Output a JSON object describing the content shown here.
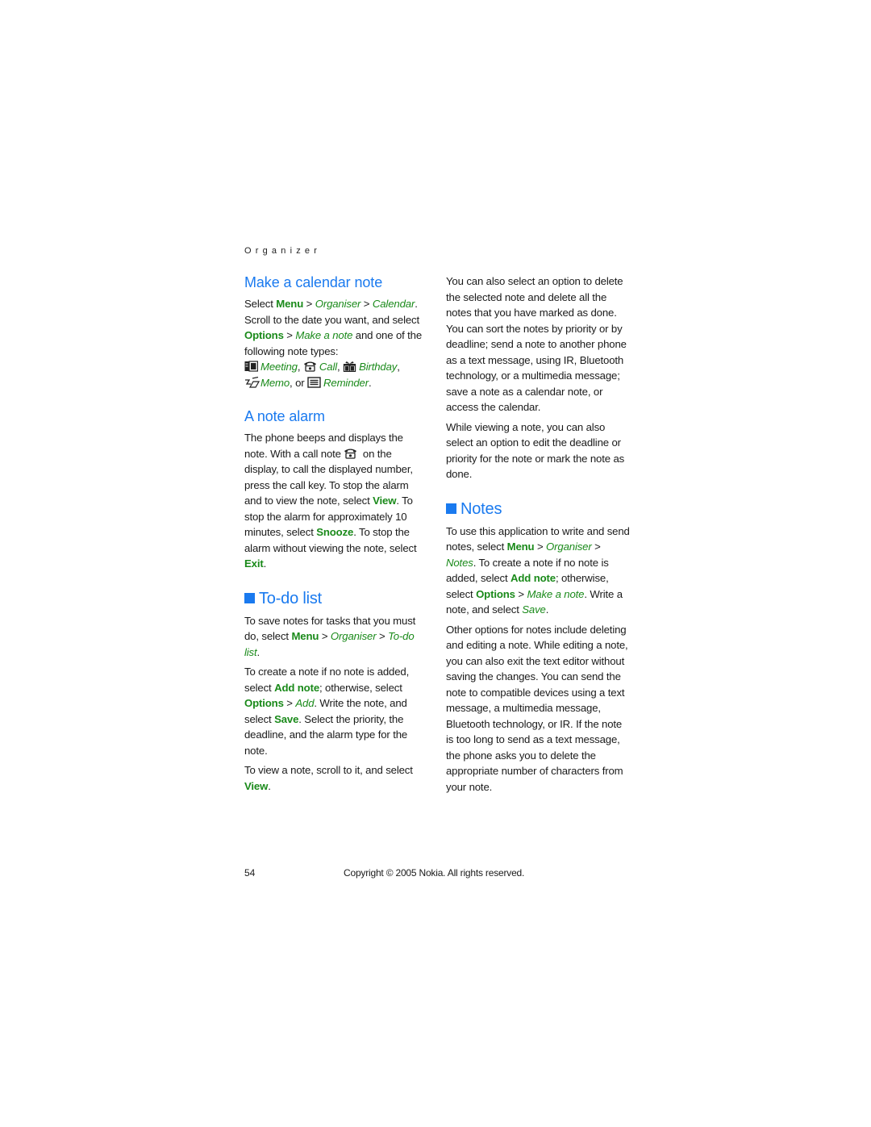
{
  "running_head": "Organizer",
  "left_column": {
    "calendar_note": {
      "heading": "Make a calendar note",
      "p1": {
        "t1": "Select ",
        "menu": "Menu",
        "t2": " > ",
        "organiser": "Organiser",
        "t3": " > ",
        "calendar": "Calendar",
        "t4": ". Scroll to the date you want, and select ",
        "options": "Options",
        "t5": " > ",
        "make_note": "Make a note",
        "t6": " and one of the following note types:"
      },
      "note_types": [
        {
          "icon": "meeting-icon",
          "label": "Meeting",
          "sep": ", "
        },
        {
          "icon": "call-icon",
          "label": "Call",
          "sep": ", "
        },
        {
          "icon": "birthday-icon",
          "label": "Birthday",
          "sep": ","
        },
        {
          "icon": "memo-icon",
          "label": "Memo",
          "sep": ", or "
        },
        {
          "icon": "reminder-icon",
          "label": "Reminder",
          "sep": "."
        }
      ]
    },
    "note_alarm": {
      "heading": "A note alarm",
      "t1": "The phone beeps and displays the note. With a call note ",
      "t2": " on the display, to call the displayed number, press the call key. To stop the alarm and to view the note, select ",
      "view": "View",
      "t3": ". To stop the alarm for approximately 10 minutes, select ",
      "snooze": "Snooze",
      "t4": ". To stop the alarm without viewing the note, select ",
      "exit": "Exit",
      "t5": "."
    },
    "todo": {
      "heading": "To-do list",
      "p1": {
        "t1": "To save notes for tasks that you must do, select ",
        "menu": "Menu",
        "t2": " > ",
        "organiser": "Organiser",
        "t3": " > ",
        "todo_list": "To-do list",
        "t4": "."
      },
      "p2": {
        "t1": "To create a note if no note is added, select ",
        "add_note": "Add note",
        "t2": "; otherwise, select ",
        "options": "Options",
        "t3": " > ",
        "add": "Add",
        "t4": ". Write the note, and select ",
        "save": "Save",
        "t5": ". Select the priority, the deadline, and the alarm type for the note."
      },
      "p3": {
        "t1": "To view a note, scroll to it, and select ",
        "view": "View",
        "t2": "."
      }
    }
  },
  "right_column": {
    "p1": "You can also select an option to delete the selected note and delete all the notes that you have marked as done. You can sort the notes by priority or by deadline; send a note to another phone as a text message, using IR, Bluetooth technology, or a multimedia message; save a note as a calendar note, or access the calendar.",
    "p2": "While viewing a note, you can also select an option to edit the deadline or priority for the note or mark the note as done.",
    "notes": {
      "heading": "Notes",
      "p1": {
        "t1": "To use this application to write and send notes, select ",
        "menu": "Menu",
        "t2": " > ",
        "organiser": "Organiser",
        "t3": " > ",
        "notes": "Notes",
        "t4": ". To create a note if no note is added, select ",
        "add_note": "Add note",
        "t5": "; otherwise, select ",
        "options": "Options",
        "t6": " > ",
        "make_note": "Make a note",
        "t7": ". Write a note, and select ",
        "save": "Save",
        "t8": "."
      },
      "p2": "Other options for notes include deleting and editing a note. While editing a note, you can also exit the text editor without saving the changes. You can send the note to compatible devices using a text message, a multimedia message, Bluetooth technology, or IR. If the note is too long to send as a text message, the phone asks you to delete the appropriate number of characters from your note."
    }
  },
  "footer": {
    "page_number": "54",
    "copyright": "Copyright © 2005 Nokia. All rights reserved."
  },
  "colors": {
    "heading_blue": "#1a7aef",
    "menu_green": "#1a8a1a"
  }
}
